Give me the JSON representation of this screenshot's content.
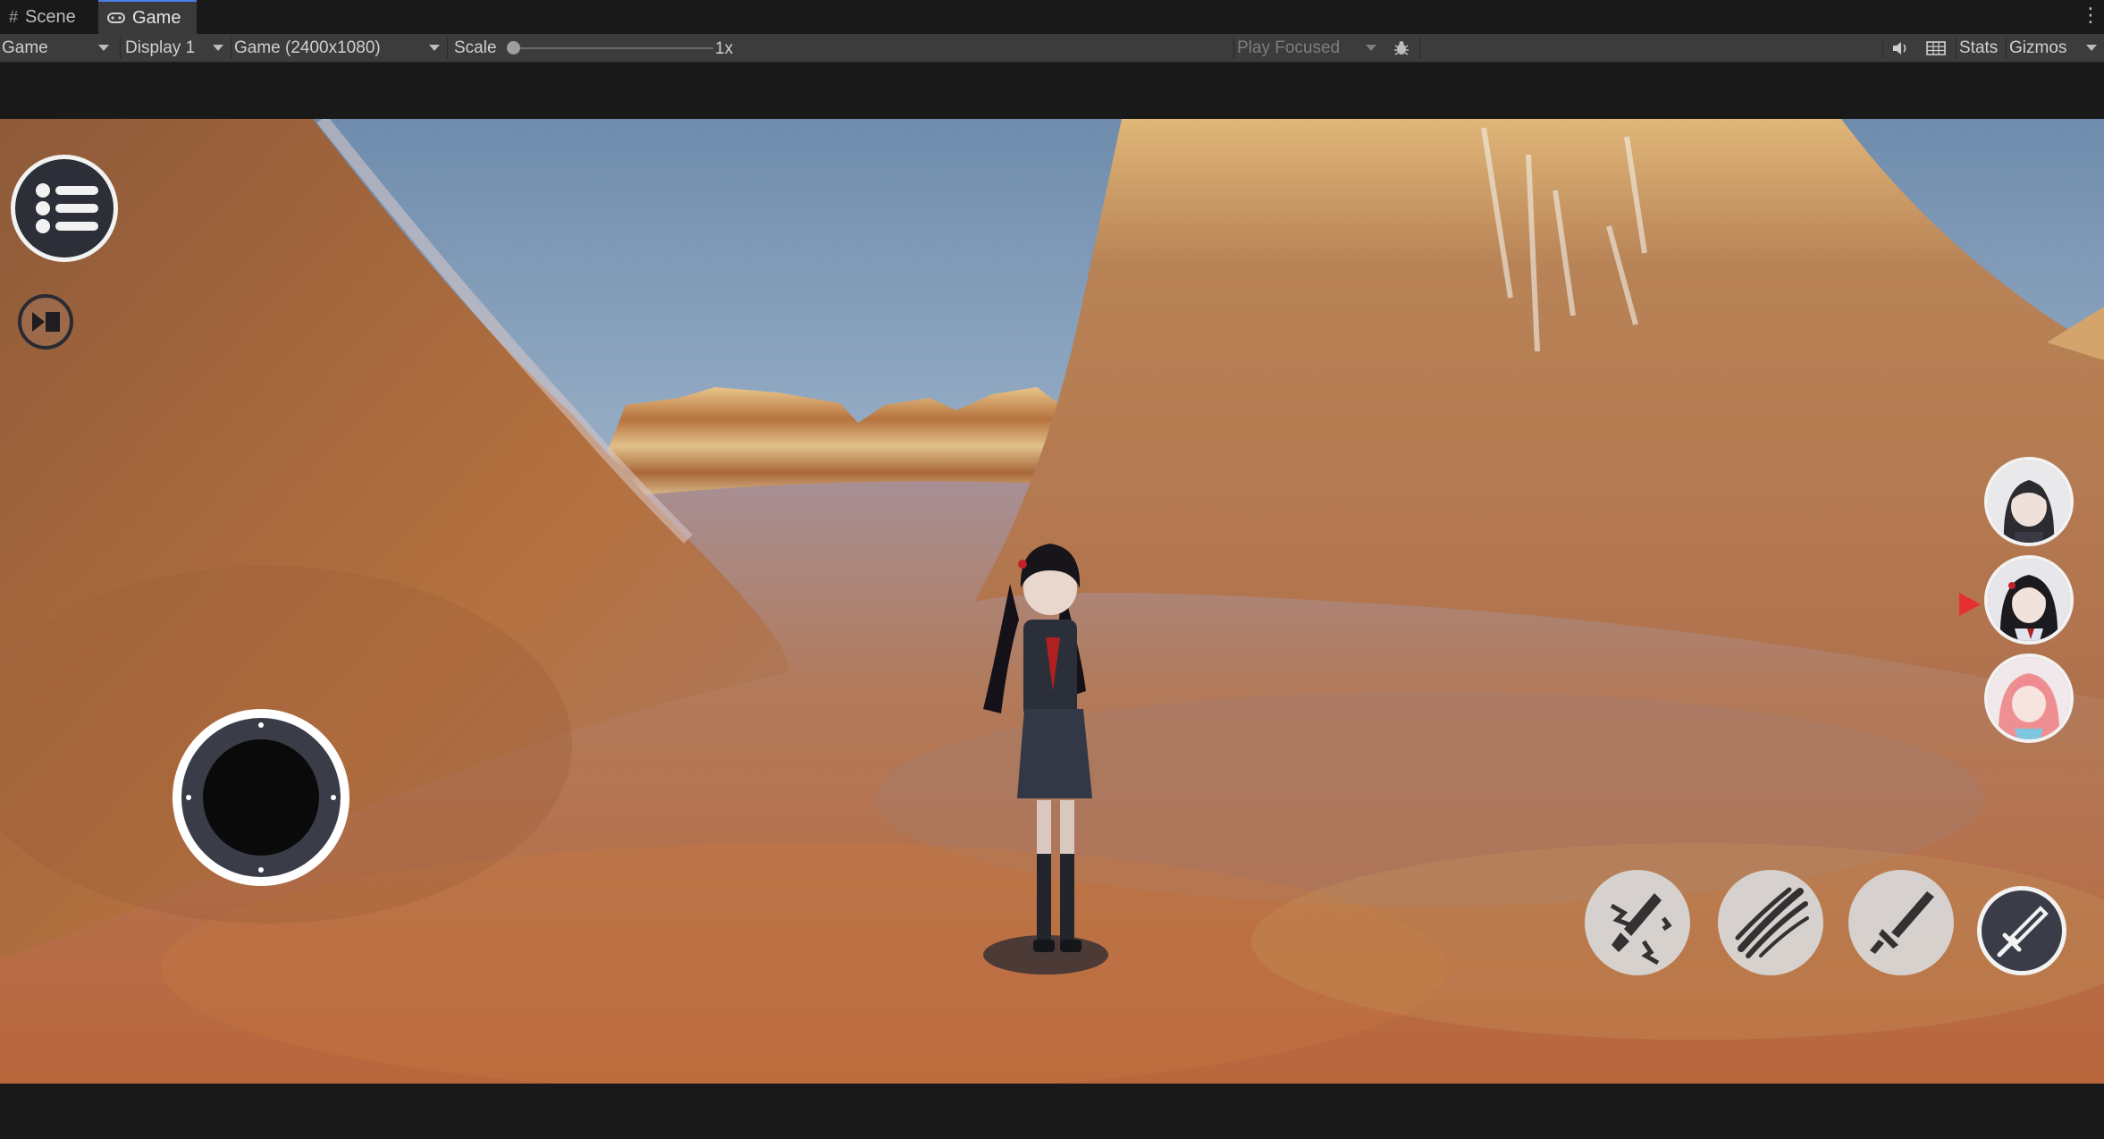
{
  "tabs": [
    {
      "label": "Scene",
      "icon": "grid-icon"
    },
    {
      "label": "Game",
      "icon": "gamepad-icon"
    }
  ],
  "toolbar": {
    "mode": "Game",
    "display": "Display 1",
    "resolution": "Game (2400x1080)",
    "scale_label": "Scale",
    "scale_value": "1x",
    "play_mode": "Play Focused",
    "stats": "Stats",
    "gizmos": "Gizmos"
  },
  "hud": {
    "menu_icon": "list-menu-icon",
    "skip_icon": "skip-forward-icon",
    "joystick_icon": "virtual-joystick",
    "party": [
      {
        "icon": "character-portrait-dark-hair",
        "active": false
      },
      {
        "icon": "character-portrait-long-black-hair",
        "active": true
      },
      {
        "icon": "character-portrait-pink-hair",
        "active": false
      }
    ],
    "skills": [
      {
        "icon": "lightning-sword-icon"
      },
      {
        "icon": "slash-claw-icon"
      },
      {
        "icon": "sword-icon"
      },
      {
        "icon": "attack-sword-icon"
      }
    ]
  },
  "colors": {
    "editor_bg": "#191919",
    "toolbar_bg": "#3c3c3c",
    "sky": "#7c96b4",
    "ground": "#b0693e",
    "active_marker": "#e53030"
  }
}
